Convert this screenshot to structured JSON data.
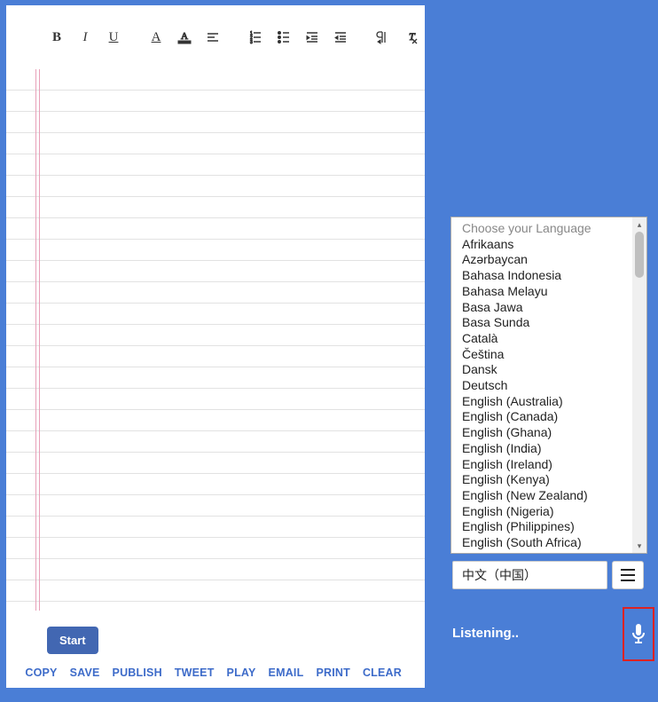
{
  "toolbar": {
    "bold": "B",
    "italic": "I",
    "underline": "U",
    "textcolor": "A",
    "highlight": "A",
    "align": "align",
    "ol": "ol",
    "ul": "ul",
    "outdent": "outdent",
    "indent": "indent",
    "rtl": "rtl",
    "clearformat": "clear"
  },
  "start_label": "Start",
  "actions": {
    "copy": "COPY",
    "save": "SAVE",
    "publish": "PUBLISH",
    "tweet": "TWEET",
    "play": "PLAY",
    "email": "EMAIL",
    "print": "PRINT",
    "clear": "CLEAR"
  },
  "language": {
    "placeholder": "Choose your Language",
    "options": [
      "Afrikaans",
      "Azərbaycan",
      "Bahasa Indonesia",
      "Bahasa Melayu",
      "Basa Jawa",
      "Basa Sunda",
      "Català",
      "Čeština",
      "Dansk",
      "Deutsch",
      "English (Australia)",
      "English (Canada)",
      "English (Ghana)",
      "English (India)",
      "English (Ireland)",
      "English (Kenya)",
      "English (New Zealand)",
      "English (Nigeria)",
      "English (Philippines)",
      "English (South Africa)"
    ],
    "selected": "中文（中国）"
  },
  "status": "Listening.."
}
